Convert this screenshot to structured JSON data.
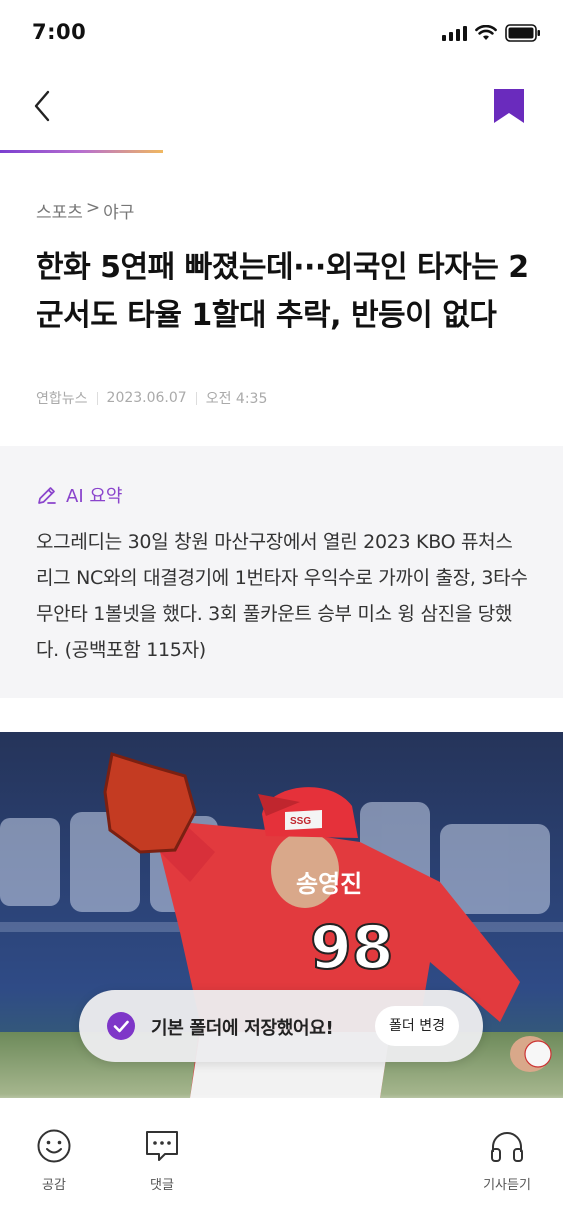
{
  "status_bar": {
    "time": "7:00"
  },
  "header": {
    "back_icon": "chevron-left-icon",
    "bookmark_icon": "bookmark-filled-icon",
    "accent_color": "#6a2bbd",
    "read_progress": 0.29
  },
  "article": {
    "breadcrumb": {
      "section": "스포츠",
      "separator": ">",
      "subsection": "야구"
    },
    "title": "한화 5연패 빠졌는데···외국인 타자는 2군서도 타율 1할대 추락, 반등이 없다",
    "source": "연합뉴스",
    "date": "2023.06.07",
    "time": "오전 4:35"
  },
  "summary": {
    "label": "AI 요약",
    "label_icon": "pencil-icon",
    "label_color": "#8a44cc",
    "text": "오그레디는 30일 창원 마산구장에서 열린 2023 KBO 퓨처스리그 NC와의 대결경기에 1번타자 우익수로 가까이 출장, 3타수 무안타 1볼넷을 했다. 3회 풀카운트 승부 미소 윙 삼진을 당했다. (공백포함 115자)"
  },
  "photo": {
    "jersey_name": "송영진",
    "jersey_number": "98",
    "cap_logo": "SSG"
  },
  "toast": {
    "icon": "check-circle-icon",
    "message": "기본 폴더에 저장했어요!",
    "action_label": "폴더 변경"
  },
  "bottom_bar": {
    "like": {
      "label": "공감",
      "icon": "smile-icon"
    },
    "comment": {
      "label": "댓글",
      "icon": "comment-icon"
    },
    "listen": {
      "label": "기사듣기",
      "icon": "headphones-icon"
    }
  }
}
